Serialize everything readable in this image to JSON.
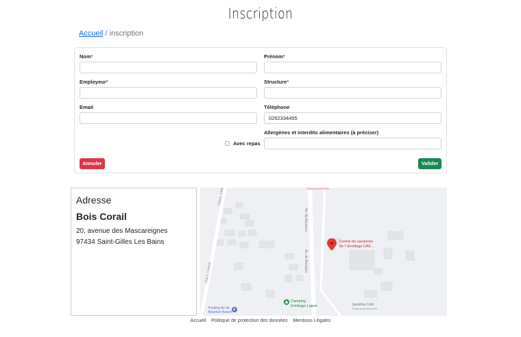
{
  "page": {
    "title": "Inscription"
  },
  "breadcrumb": {
    "home": "Accueil",
    "separator": " / ",
    "current": "inscription"
  },
  "form": {
    "nom": {
      "label": "Nom",
      "required_mark": "*",
      "value": ""
    },
    "prenom": {
      "label": "Prénom",
      "required_mark": "*",
      "value": ""
    },
    "employeur": {
      "label": "Employeur",
      "required_mark": "*",
      "value": ""
    },
    "structure": {
      "label": "Structure",
      "required_mark": "*",
      "value": ""
    },
    "email": {
      "label": "Email",
      "value": ""
    },
    "telephone": {
      "label": "Téléphone",
      "value": "0262334455"
    },
    "allergenes": {
      "label": "Allergènes et interdits alimentaires (à préciser)",
      "value": ""
    },
    "avec_repas": {
      "label": "Avec repas",
      "checked": false
    },
    "cancel_label": "Annuler",
    "submit_label": "Valider"
  },
  "address": {
    "heading": "Adresse",
    "name": "Bois Corail",
    "line1": "20, avenue des Mascareignes",
    "line2": "97434 Saint-Gilles Les Bains"
  },
  "map": {
    "pin_label_1": "Centre de vacances",
    "pin_label_2": "de l' Ermitage CAF...",
    "roads": [
      "Chem. Littoral",
      "Av. de Bourbon",
      "Av. de Bourbon",
      "Chem. Littoral"
    ],
    "poi_camping_1": "Camping",
    "poi_camping_2": "Ermitage Lagon",
    "poi_parking_1": "Parking Av de",
    "poi_parking_2": "Bourbon Beach",
    "poi_cafe_1": "Ipanéma Café",
    "poi_cafe_2": "Fermé temporairement",
    "colors": {
      "pin": "#e53935",
      "camping": "#1e8e3e",
      "road": "#ffffff",
      "building": "#e2e4e8"
    }
  },
  "footer": {
    "links": [
      "Accueil",
      "Politique de protection des données",
      "Mentions Légales"
    ]
  }
}
